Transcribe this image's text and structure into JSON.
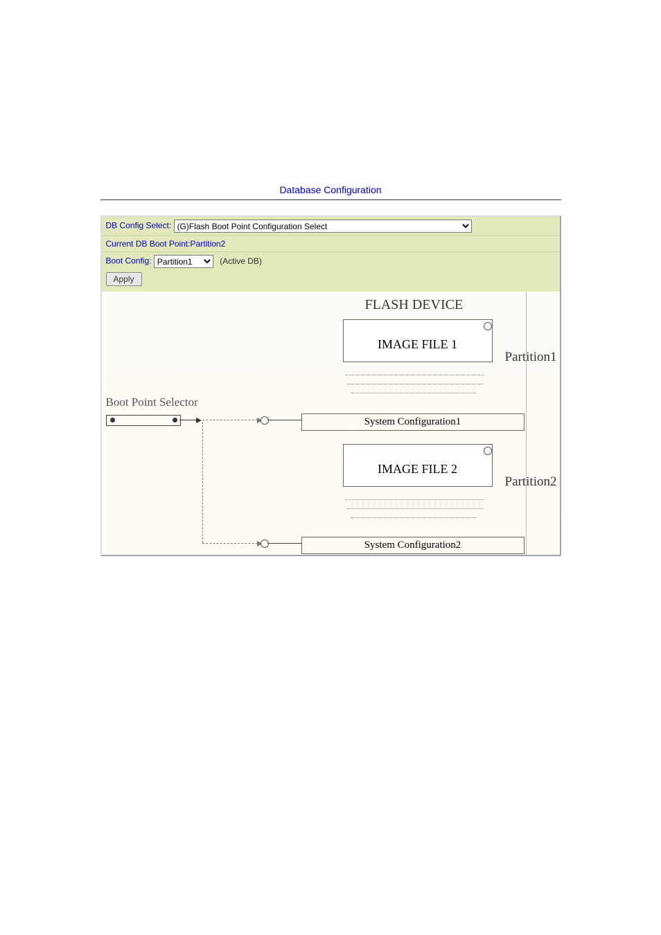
{
  "title": "Database Configuration",
  "form": {
    "db_config_label": "DB Config Select:",
    "db_config_value": "(G)Flash Boot Point Configuration Select",
    "current_boot_text": "Current DB Boot Point:Partition2",
    "boot_config_label": "Boot Config:",
    "boot_config_value": "Partition1",
    "active_note": "(Active DB)",
    "apply_label": "Apply"
  },
  "diagram": {
    "flash_header": "FLASH DEVICE",
    "image1": "IMAGE FILE 1",
    "image2": "IMAGE FILE 2",
    "sys1": "System Configuration1",
    "sys2": "System Configuration2",
    "partition1": "Partition1",
    "partition2": "Partition2",
    "selector_label": "Boot Point Selector"
  }
}
